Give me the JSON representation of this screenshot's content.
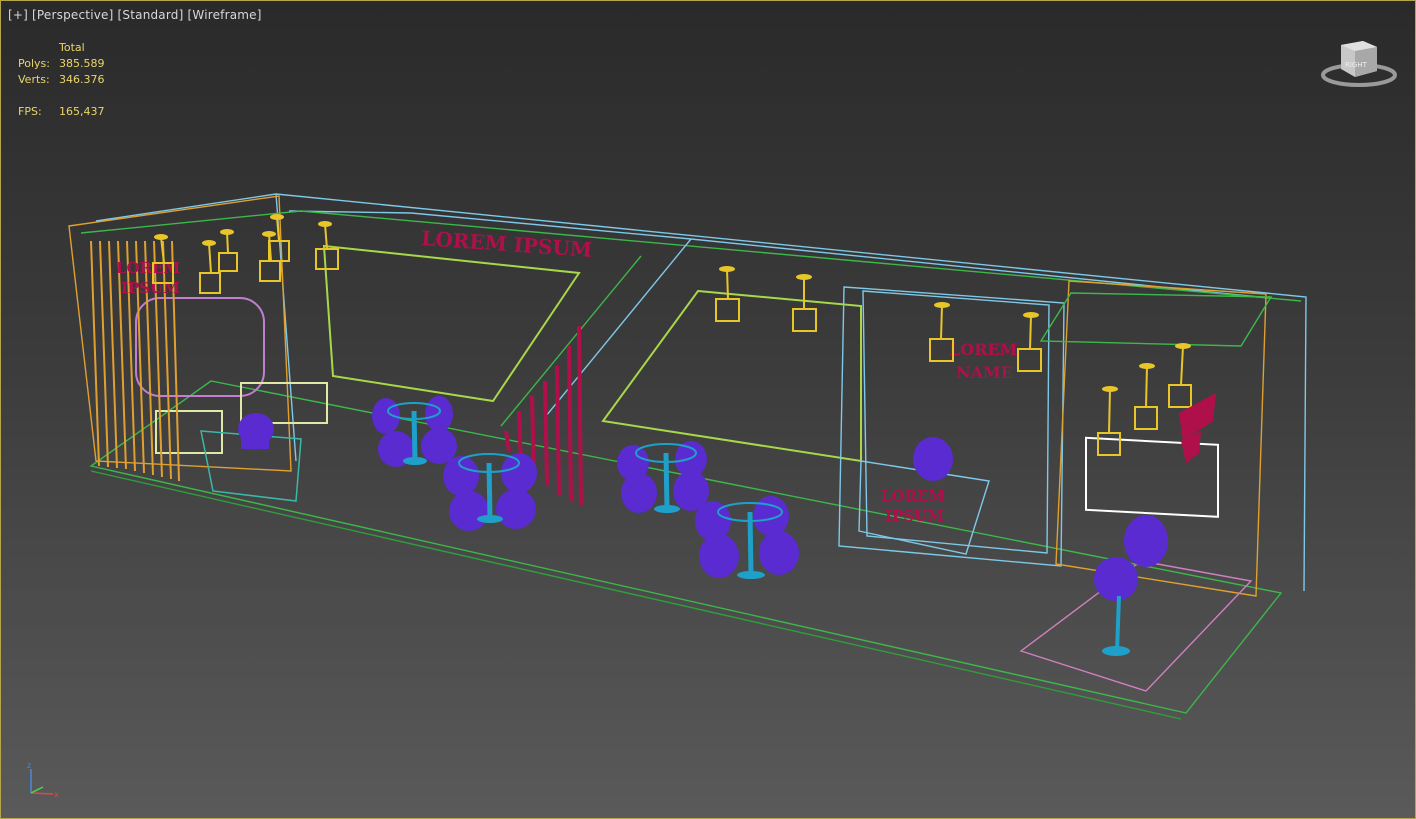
{
  "viewport": {
    "label_segments": [
      "[+]",
      "[Perspective]",
      "[Standard]",
      "[Wireframe]"
    ]
  },
  "stats": {
    "header": "Total",
    "polys_label": "Polys:",
    "polys_value": "385.589",
    "verts_label": "Verts:",
    "verts_value": "346.376",
    "fps_label": "FPS:",
    "fps_value": "165,437"
  },
  "scene_text": {
    "sign_top": "LOREM IPSUM",
    "sign_left_1": "LOREM",
    "sign_left_2": "IPSUM",
    "sign_right_1": "LOREM",
    "sign_right_2": "NAME",
    "counter_1": "LOREM",
    "counter_2": "IPSUM"
  },
  "viewcube": {
    "icon": "viewcube-icon",
    "face": "RIGHT"
  },
  "axis_tripod": {
    "icon": "axis-tripod-icon",
    "z": "z",
    "x": "x"
  },
  "colors": {
    "chairs": "#5a2bd0",
    "lamps": "#e8c62a",
    "signage": "#b0104a",
    "table_post": "#1fa0c8",
    "wire_green": "#3cb84a",
    "wire_cyan": "#7ec8e8",
    "wire_orange": "#e0a030",
    "wire_pink": "#d080c0"
  }
}
